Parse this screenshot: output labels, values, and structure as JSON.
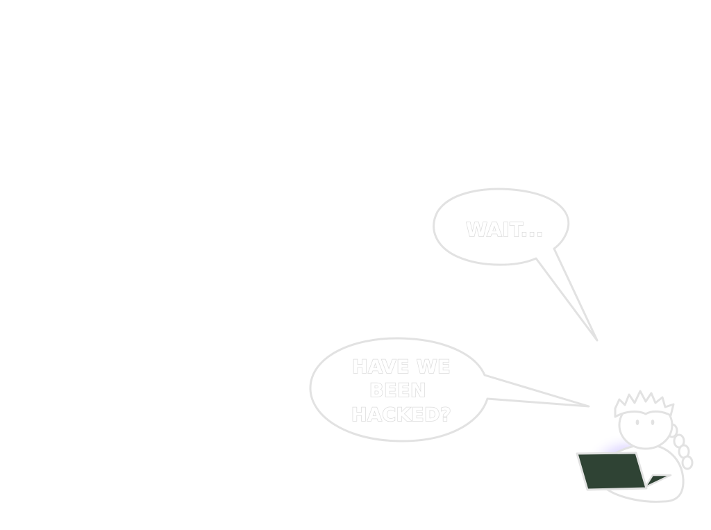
{
  "scene": {
    "bubble_1": {
      "text": "WAIT..."
    },
    "bubble_2": {
      "lines": [
        "HAVE WE",
        "BEEN",
        "HACKED?"
      ]
    }
  },
  "colors": {
    "background": "#ffffff",
    "outline": "#e0e0e0",
    "text_outline": "#dcdcdc",
    "laptop_screen": "#2f4334",
    "glow": "#c8b8ff"
  }
}
